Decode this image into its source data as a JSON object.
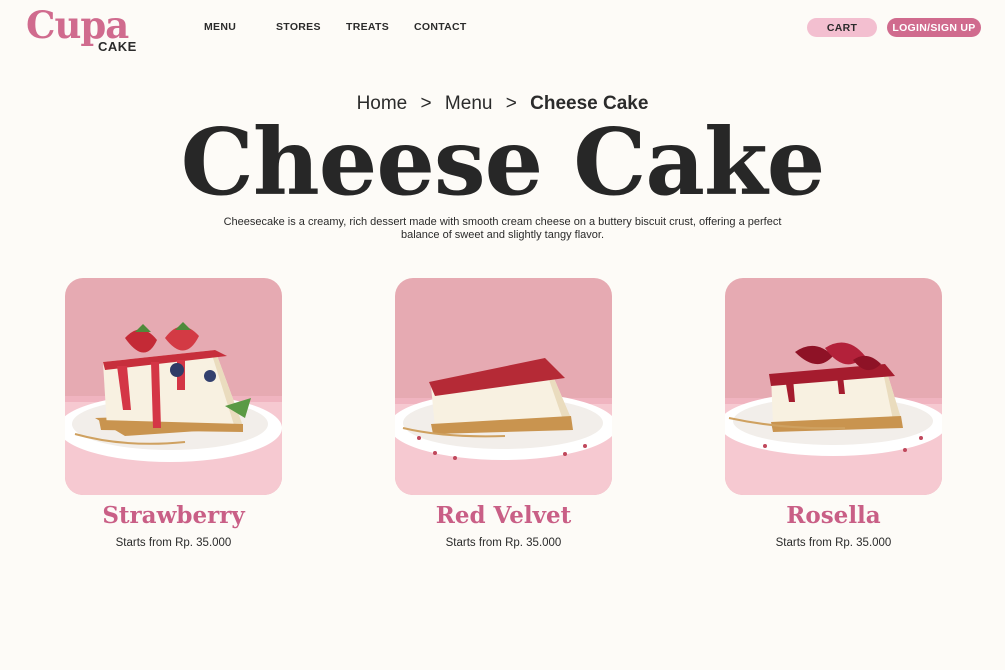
{
  "brand": {
    "name": "Cupa",
    "sub": "CAKE",
    "color": "#d06b8e"
  },
  "nav": {
    "items": [
      {
        "label": "MENU"
      },
      {
        "label": "STORES"
      },
      {
        "label": "TREATS"
      },
      {
        "label": "CONTACT"
      }
    ],
    "cart_label": "CART",
    "login_label": "LOGIN/SIGN UP"
  },
  "breadcrumb": {
    "home": "Home",
    "menu": "Menu",
    "current": "Cheese Cake",
    "separator": ">"
  },
  "page": {
    "title": "Cheese Cake",
    "description": "Cheesecake is a creamy, rich dessert made with smooth cream cheese on a buttery biscuit crust, offering a perfect balance of sweet and slightly tangy flavor."
  },
  "products": [
    {
      "name": "Strawberry",
      "price": "Starts from Rp. 35.000",
      "topping": "strawberry"
    },
    {
      "name": "Red Velvet",
      "price": "Starts from Rp. 35.000",
      "topping": "red-velvet-crumb"
    },
    {
      "name": "Rosella",
      "price": "Starts from Rp. 35.000",
      "topping": "rosella-jam"
    }
  ],
  "colors": {
    "accent": "#d06b8e",
    "accent_light": "#f3bfd0",
    "background": "#fdfbf7",
    "text": "#2b2b2b"
  }
}
